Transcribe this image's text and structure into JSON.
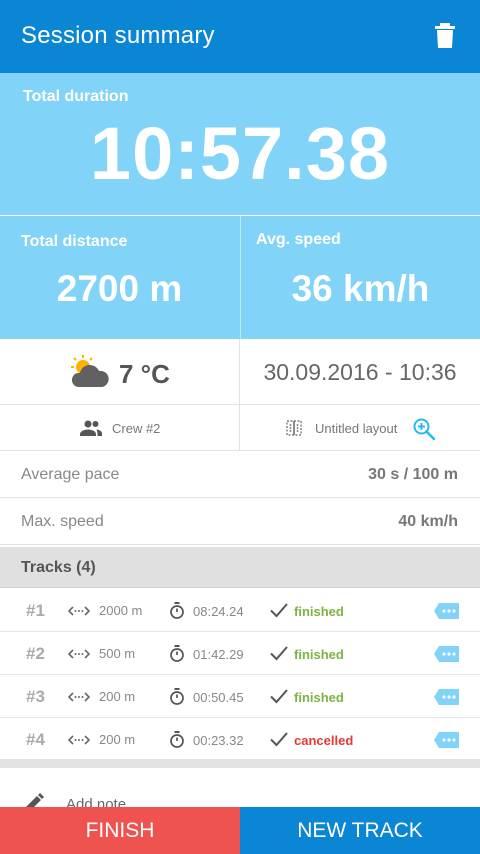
{
  "appbar": {
    "title": "Session summary",
    "delete_icon": "trash-icon"
  },
  "duration": {
    "label": "Total duration",
    "value": "10:57.38"
  },
  "distance": {
    "label": "Total distance",
    "value": "2700 m"
  },
  "speed": {
    "label": "Avg. speed",
    "value": "36 km/h"
  },
  "weather": {
    "icon": "partly-cloudy-icon",
    "temperature": "7 °C"
  },
  "datetime": "30.09.2016 - 10:36",
  "crew": {
    "icon": "people-icon",
    "label": "Crew #2"
  },
  "layout": {
    "icon": "layout-icon",
    "label": "Untitled layout",
    "zoom_icon": "zoom-in-icon"
  },
  "metrics": [
    {
      "key": "Average pace",
      "value": "30 s / 100 m"
    },
    {
      "key": "Max. speed",
      "value": "40 km/h"
    }
  ],
  "tracks": {
    "header": "Tracks (4)",
    "items": [
      {
        "num": "#1",
        "distance": "2000 m",
        "time": "08:24.24",
        "status": "finished"
      },
      {
        "num": "#2",
        "distance": "500 m",
        "time": "01:42.29",
        "status": "finished"
      },
      {
        "num": "#3",
        "distance": "200 m",
        "time": "00:50.45",
        "status": "finished"
      },
      {
        "num": "#4",
        "distance": "200 m",
        "time": "00:23.32",
        "status": "cancelled"
      }
    ]
  },
  "note": {
    "label": "Add note",
    "icon": "pencil-icon"
  },
  "buttons": {
    "finish": "FINISH",
    "new_track": "NEW TRACK"
  },
  "colors": {
    "primary": "#0b86d4",
    "header_light": "#81d3f8",
    "finished": "#7cb342",
    "cancelled": "#e53935",
    "finish_button": "#ef5350"
  }
}
